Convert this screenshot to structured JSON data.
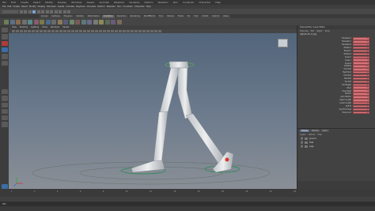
{
  "titlebar": {
    "items": [
      "File",
      "Edit",
      "Create",
      "Select",
      "Modify",
      "Display",
      "Windows",
      "Assets",
      "Animate",
      "Playback",
      "Visualize",
      "Deform",
      "Skeleton",
      "Skin",
      "Constrain",
      "Character",
      "Help"
    ]
  },
  "menubar": {
    "items": [
      "File",
      "Edit",
      "Create",
      "Select",
      "Modify",
      "Display",
      "Windows",
      "Assets",
      "Animate",
      "Playback",
      "Visualize",
      "Deform",
      "Skeleton",
      "Skin",
      "Constrain",
      "Character",
      "Help"
    ]
  },
  "shelf_tabs": [
    "Curves",
    "Surfaces",
    "Polygons",
    "Subdivs",
    "Deformation",
    "Animation",
    "Dynamics",
    "Rendering",
    "PaintEffects",
    "Toon",
    "Muscle",
    "Fluids",
    "Fur",
    "Hair",
    "nCloth",
    "Custom",
    "XGen"
  ],
  "active_shelf_tab": "Animation",
  "panel_menu": [
    "View",
    "Shading",
    "Lighting",
    "Show",
    "Renderer",
    "Panels"
  ],
  "viewcube_label": "",
  "channel_box": {
    "title": "Channel Box / Layer Editor",
    "menu": [
      "Channels",
      "Edit",
      "Object",
      "Show"
    ],
    "node": "rigfoot:ctrl_lf_leg",
    "attributes": [
      {
        "name": "Translate X",
        "value": "0"
      },
      {
        "name": "Translate Y",
        "value": "0"
      },
      {
        "name": "Translate Z",
        "value": "0"
      },
      {
        "name": "Rotate X",
        "value": "0"
      },
      {
        "name": "Rotate Y",
        "value": "0"
      },
      {
        "name": "Rotate Z",
        "value": "0"
      },
      {
        "name": "Scale X",
        "value": "1"
      },
      {
        "name": "Scale Y",
        "value": "1"
      },
      {
        "name": "Scale Z",
        "value": "1"
      },
      {
        "name": "Visibility",
        "value": "on"
      },
      {
        "name": "Foot Roll",
        "value": "0"
      },
      {
        "name": "Heel Pivot",
        "value": "0"
      },
      {
        "name": "Toe Pivot",
        "value": "0"
      },
      {
        "name": "Ball Roll",
        "value": "0"
      },
      {
        "name": "Toe Roll",
        "value": "0"
      },
      {
        "name": "Toe Wiggle",
        "value": "0"
      },
      {
        "name": "Bank",
        "value": "0"
      },
      {
        "name": "Knee Twist",
        "value": "0"
      },
      {
        "name": "Stretch",
        "value": "0"
      },
      {
        "name": "Auto Stretch",
        "value": "1"
      },
      {
        "name": "Upper Length",
        "value": "1"
      },
      {
        "name": "Lower Length",
        "value": "1"
      },
      {
        "name": "Soft IK",
        "value": "0"
      },
      {
        "name": "Leg Thickness",
        "value": "1"
      },
      {
        "name": "Knee Lock",
        "value": "0"
      }
    ],
    "layer_tabs": [
      "Display",
      "Render",
      "Anim"
    ],
    "active_layer_tab": "Display",
    "layer_menu": [
      "Layers",
      "Options",
      "Help"
    ],
    "layers": [
      {
        "v": "V",
        "name": "ground"
      },
      {
        "v": "V",
        "name": "Feet"
      },
      {
        "v": "V",
        "name": "Legs"
      }
    ]
  },
  "timeline": {
    "ticks": [
      "1",
      "2",
      "4",
      "6",
      "8",
      "10",
      "12",
      "14",
      "16",
      "18",
      "20",
      "22",
      "24"
    ]
  },
  "command_line": {
    "label": "MEL"
  }
}
